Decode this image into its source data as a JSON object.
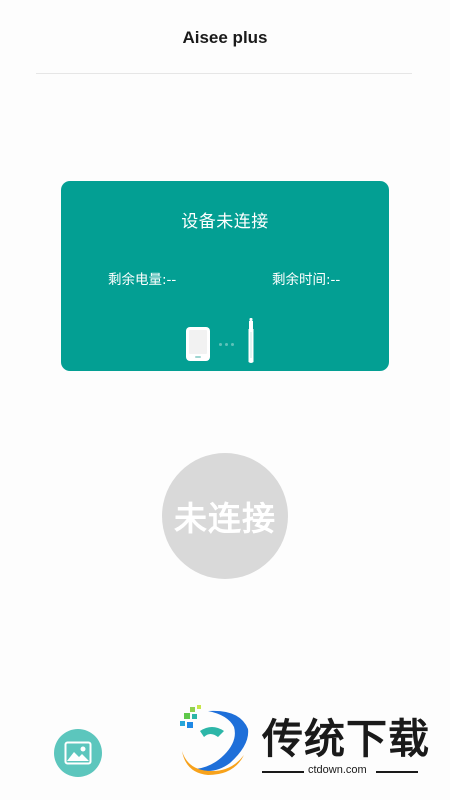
{
  "header": {
    "title": "Aisee plus"
  },
  "device_card": {
    "status": "设备未连接",
    "battery_label": "剩余电量:--",
    "time_label": "剩余时间:--"
  },
  "connect_button": {
    "label": "未连接"
  },
  "watermark": {
    "brand_text": "传统下载",
    "url": "ctdown.com"
  },
  "colors": {
    "card": "#039f93",
    "button_idle": "#d9d9d9",
    "gallery_button": "#5cc6bd"
  },
  "icons": [
    "phone-icon",
    "connecting-dots-icon",
    "otoscope-pen-icon",
    "gallery-icon",
    "watermark-logo-icon"
  ]
}
